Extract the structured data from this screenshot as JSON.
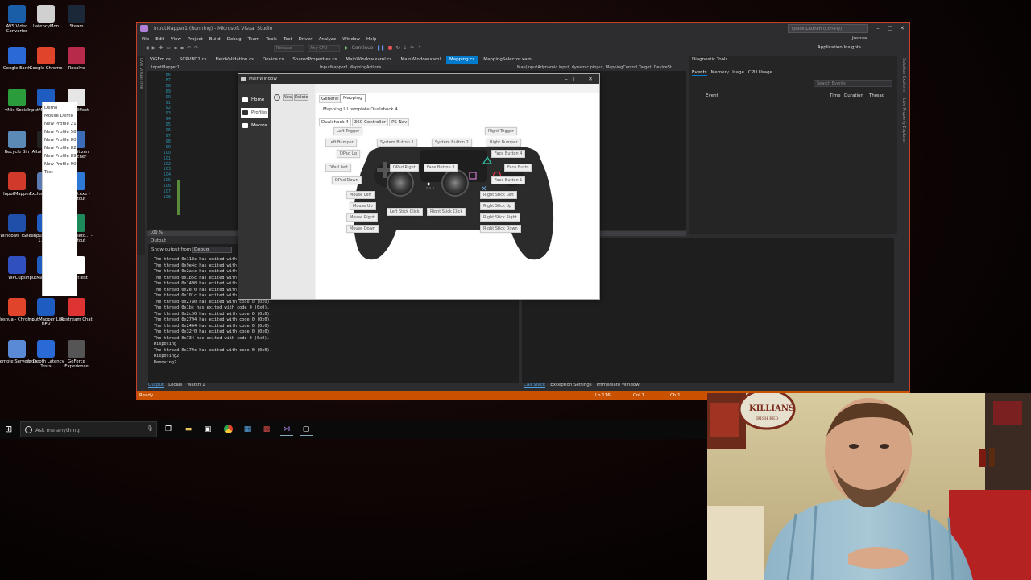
{
  "desktop": {
    "icons": [
      {
        "label": "AVS Video Converter",
        "color": "#1a5ea8"
      },
      {
        "label": "LatencyMon",
        "color": "#d0d0d0"
      },
      {
        "label": "Steam",
        "color": "#1b2838"
      },
      {
        "label": "Google Earth",
        "color": "#2b6ad6"
      },
      {
        "label": "Google Chrome",
        "color": "#e0452b"
      },
      {
        "label": "Resolve",
        "color": "#b82a4a"
      },
      {
        "label": "vMix Social",
        "color": "#2a9c3c"
      },
      {
        "label": "InputMapp... Dev",
        "color": "#1f5cc2"
      },
      {
        "label": "Mass Effect",
        "color": "#e6e6e6"
      },
      {
        "label": "Recycle Bin",
        "color": "#5a8ab5"
      },
      {
        "label": "Altair-vMix-...",
        "color": "#222"
      },
      {
        "label": "Star Citizen Launcher",
        "color": "#3c6bb8"
      },
      {
        "label": "InputMapper",
        "color": "#d03a2a"
      },
      {
        "label": "Exclusive Mode Tool",
        "color": "#5a7ab0"
      },
      {
        "label": "vMix64.exe - Shortcut",
        "color": "#2d7ad6"
      },
      {
        "label": "Windows TShell",
        "color": "#1f4fa8"
      },
      {
        "label": "InputMapper 1.6.dev",
        "color": "#1f5cc2"
      },
      {
        "label": "vMixDeskto... - Shortcut",
        "color": "#1e8a5a"
      },
      {
        "label": "WPCups",
        "color": "#3050c0"
      },
      {
        "label": "InputMapper 2 Dev",
        "color": "#1f5cc2"
      },
      {
        "label": "XInputTest",
        "color": "#ffffff"
      },
      {
        "label": "Joshua - Chrome",
        "color": "#e0452b"
      },
      {
        "label": "InputMapper Lite DEV",
        "color": "#1f5cc2"
      },
      {
        "label": "Restream Chat",
        "color": "#d33"
      },
      {
        "label": "Remote Server.rdp",
        "color": "#5a8ad6"
      },
      {
        "label": "In Depth Latency Tests",
        "color": "#2a6ad6"
      },
      {
        "label": "GeForce Experience",
        "color": "#555"
      }
    ]
  },
  "vs": {
    "title": "InputMapper1 (Running) - Microsoft Visual Studio",
    "quick_launch": "Quick Launch (Ctrl+Q)",
    "user": "Joshua",
    "menu": [
      "File",
      "Edit",
      "View",
      "Project",
      "Build",
      "Debug",
      "Team",
      "Tools",
      "Test",
      "Driver",
      "Analyze",
      "Window",
      "Help"
    ],
    "toolbar": {
      "config": "Release",
      "platform": "Any CPU",
      "continue": "Continue",
      "app_insights": "Application Insights"
    },
    "doc_tabs": [
      "ViGEm.cs",
      "SCPVBD1.cs",
      "FieldValidation.cs",
      "Device.cs",
      "SharedProperties.cs",
      "MainWindow.xaml.cs",
      "MainWindow.xaml",
      "Mapping.cs",
      "MappingSelector.xaml"
    ],
    "active_tab": "Mapping.cs",
    "editor_nav": {
      "project": "InputMapper1",
      "member": "InputMapper1.MappingActions",
      "right": "Map(inputAdynamic input, dynamic pinput, MappingControl Target, DeviceSt"
    },
    "line_numbers": [
      "86",
      "87",
      "88",
      "89",
      "90",
      "91",
      "92",
      "93",
      "94",
      "95",
      "96",
      "97",
      "98",
      "99",
      "100",
      "101",
      "102",
      "103",
      "104",
      "105",
      "106",
      "107",
      "108"
    ],
    "zoom": "100 %",
    "side_left": "Live Visual Tree",
    "diagnostic": {
      "title": "Diagnostic Tools",
      "tabs": [
        "Events",
        "Memory Usage",
        "CPU Usage"
      ],
      "search_placeholder": "Search Events",
      "columns": [
        "Event",
        "Time",
        "Duration",
        "Thread"
      ]
    },
    "rail": [
      "Solution Explorer",
      "Live Property Explorer"
    ],
    "output": {
      "title": "Output",
      "show_from": "Show output from:",
      "source": "Debug",
      "lines": [
        "The thread 0x118c has exited with code 0 (0x0).",
        "The thread 0x9e4c has exited with code 0 (0x0).",
        "The thread 0x2acc has exited with code 0 (0x0).",
        "The thread 0x1b5c has exited with code 0 (0x0).",
        "The thread 0x1498 has exited with code 0 (0x0).",
        "The thread 0x2e70 has exited with code 0 (0x0).",
        "The thread 0x101c has exited with code 0 (0x0).",
        "The thread 0x27a0 has exited with code 0 (0x0).",
        "The thread 0x1bc has exited with code 0 (0x0).",
        "The thread 0x2c30 has exited with code 0 (0x0).",
        "The thread 0x2794 has exited with code 0 (0x0).",
        "The thread 0x2464 has exited with code 0 (0x0).",
        "The thread 0x32f0 has exited with code 0 (0x0).",
        "The thread 0x734 has exited with code 0 (0x0).",
        "Disposing",
        "The thread 0x179c has exited with code 0 (0x0).",
        "Disposing2",
        "Removing2"
      ],
      "tabs": [
        "Output",
        "Locals",
        "Watch 1"
      ]
    },
    "callstack_tabs": [
      "Call Stack",
      "Exception Settings",
      "Immediate Window"
    ],
    "status": {
      "ready": "Ready",
      "ln": "Ln 116",
      "col": "Col 1",
      "ch": "Ch 1"
    }
  },
  "mainwindow": {
    "title": "MainWindow",
    "nav": [
      "Home",
      "Profiles",
      "Macros"
    ],
    "selected_nav": "Profiles",
    "btn_new": "New",
    "btn_delete": "Delete",
    "profiles": [
      "Demo",
      "Mouse Demo",
      "New Profile 21",
      "New Profile 58",
      "New Profile 80",
      "New Profile 82",
      "New Profile 89",
      "New Profile 90",
      "Test"
    ],
    "tabs": [
      "General",
      "Mapping"
    ],
    "template_label": "Mapping UI template:",
    "template_value": "Dualshock 4",
    "controller_tabs": [
      "Dualshock 4",
      "360 Controller",
      "PS Nav"
    ],
    "buttons": {
      "left_trigger": "Left Trigger",
      "left_bumper": "Left Bumper",
      "dpad_up": "DPad Up",
      "dpad_left": "DPad Left",
      "dpad_down": "DPad Down",
      "dpad_right": "DPad Right",
      "system_button_1": "System Button 1",
      "system_button_2": "System Button 2",
      "right_trigger": "Right Trigger",
      "right_bumper": "Right Bumper",
      "face_button_4": "Face Button 4",
      "face_button_3": "Face Button 3",
      "face_button_2": "Face Butto",
      "face_button_1": "Face Button 1",
      "mouse_left": "Mouse Left",
      "mouse_up": "Mouse Up",
      "mouse_right": "Mouse Right",
      "mouse_down": "Mouse Down",
      "left_stick_click": "Left Stick Click",
      "right_stick_click": "Right Stick Click",
      "right_stick_left": "Right Stick Left",
      "right_stick_up": "Right Stick Up",
      "right_stick_right": "Right Stick Right",
      "right_stick_down": "Right Stick Down"
    }
  },
  "taskbar": {
    "search_placeholder": "Ask me anything",
    "apps": [
      "task-view-icon",
      "file-explorer-icon",
      "store-icon",
      "chrome-icon",
      "vs-blend-icon",
      "visual-studio-icon",
      "vs-icon",
      "app-window-icon"
    ]
  },
  "webcam": {
    "poster_text": "KILLIANS",
    "poster_sub": "IRISH RED"
  }
}
